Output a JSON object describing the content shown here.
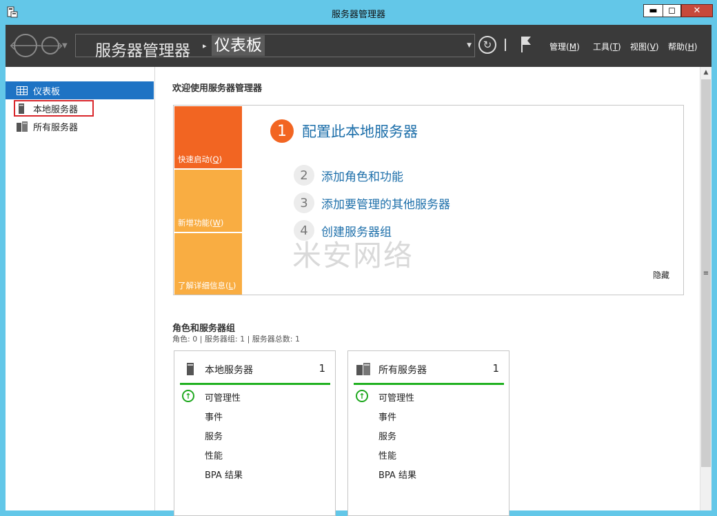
{
  "window": {
    "title": "服务器管理器",
    "minimize": "▬",
    "maximize": "◻",
    "close": "✕"
  },
  "nav": {
    "breadcrumb_root": "服务器管理器",
    "breadcrumb_separator": "▸",
    "breadcrumb_current": "仪表板",
    "menus": [
      {
        "label": "管理",
        "key": "M"
      },
      {
        "label": "工具",
        "key": "T"
      },
      {
        "label": "视图",
        "key": "V"
      },
      {
        "label": "帮助",
        "key": "H"
      }
    ]
  },
  "sidebar": {
    "items": [
      {
        "label": "仪表板",
        "icon": "dashboard-icon",
        "active": true
      },
      {
        "label": "本地服务器",
        "icon": "server-icon",
        "active": false
      },
      {
        "label": "所有服务器",
        "icon": "servers-icon",
        "active": false
      }
    ]
  },
  "main": {
    "welcome": "欢迎使用服务器管理器",
    "tiles": [
      {
        "label": "快速启动",
        "key": "Q",
        "color": "#f26522"
      },
      {
        "label": "新增功能",
        "key": "W",
        "color": "#f9ad42"
      },
      {
        "label": "了解详细信息",
        "key": "L",
        "color": "#f9ad42"
      }
    ],
    "steps": [
      {
        "num": "1",
        "label": "配置此本地服务器"
      },
      {
        "num": "2",
        "label": "添加角色和功能"
      },
      {
        "num": "3",
        "label": "添加要管理的其他服务器"
      },
      {
        "num": "4",
        "label": "创建服务器组"
      }
    ],
    "watermark": "米安网络",
    "hide": "隐藏",
    "roles_title": "角色和服务器组",
    "roles_summary": "角色: 0 | 服务器组: 1 | 服务器总数: 1",
    "cards": [
      {
        "title": "本地服务器",
        "count": "1",
        "rows": [
          "可管理性",
          "事件",
          "服务",
          "性能",
          "BPA 结果"
        ]
      },
      {
        "title": "所有服务器",
        "count": "1",
        "rows": [
          "可管理性",
          "事件",
          "服务",
          "性能",
          "BPA 结果"
        ]
      }
    ]
  },
  "colors": {
    "accent_orange": "#f26522",
    "tile_yellow": "#f9ad42",
    "link_blue": "#1d6faa",
    "status_green": "#1fb01f",
    "sidebar_active": "#1e73c4"
  }
}
